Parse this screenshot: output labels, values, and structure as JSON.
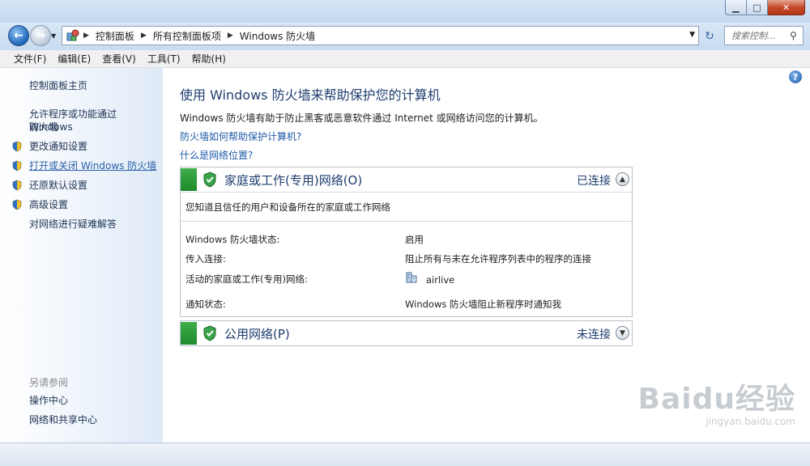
{
  "window": {
    "minimize_label": "▁",
    "maximize_label": "□",
    "close_label": "✕"
  },
  "nav": {
    "back_icon": "back-arrow-icon",
    "forward_icon": "forward-arrow-icon",
    "breadcrumb": [
      "控制面板",
      "所有控制面板项",
      "Windows 防火墙"
    ],
    "search_placeholder": "搜索控制..."
  },
  "menu": [
    "文件(F)",
    "编辑(E)",
    "查看(V)",
    "工具(T)",
    "帮助(H)"
  ],
  "sidebar": {
    "home": "控制面板主页",
    "allow_line1": "允许程序或功能通过 Windows",
    "allow_line2": "防火墙",
    "change_notify": "更改通知设置",
    "toggle": "打开或关闭 Windows 防火墙",
    "restore": "还原默认设置",
    "advanced": "高级设置",
    "troubleshoot": "对网络进行疑难解答",
    "see_also": "另请参阅",
    "action_center": "操作中心",
    "network_center": "网络和共享中心"
  },
  "main": {
    "title": "使用 Windows 防火墙来帮助保护您的计算机",
    "description": "Windows 防火墙有助于防止黑客或恶意软件通过 Internet 或网络访问您的计算机。",
    "link_help": "防火墙如何帮助保护计算机?",
    "link_location": "什么是网络位置?",
    "home_panel": {
      "title": "家庭或工作(专用)网络(O)",
      "status": "已连接",
      "subtitle": "您知道且信任的用户和设备所在的家庭或工作网络",
      "rows": [
        {
          "label": "Windows 防火墙状态:",
          "value": "启用"
        },
        {
          "label": "传入连接:",
          "value": "阻止所有与未在允许程序列表中的程序的连接"
        },
        {
          "label": "活动的家庭或工作(专用)网络:",
          "value": "airlive"
        },
        {
          "label": "通知状态:",
          "value": "Windows 防火墙阻止新程序时通知我"
        }
      ]
    },
    "public_panel": {
      "title": "公用网络(P)",
      "status": "未连接"
    }
  },
  "watermark": {
    "text": "Baidu经验",
    "url": "jingyan.baidu.com"
  },
  "colors": {
    "accent_green": "#1f8a2c",
    "link_blue": "#1e5aa8",
    "title_blue": "#1e3c6e"
  }
}
